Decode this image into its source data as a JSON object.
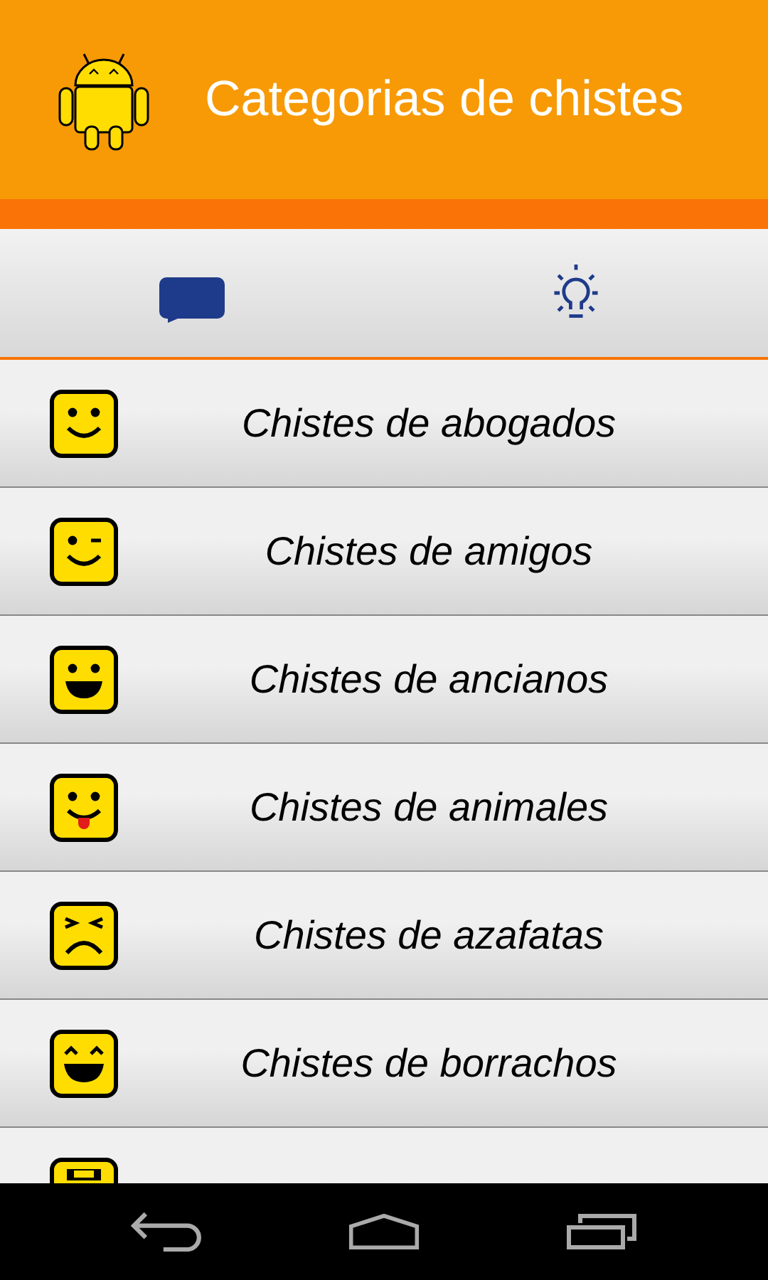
{
  "action_bar": {
    "title": "Categorias de chistes"
  },
  "tabs": [
    {
      "kind": "chat"
    },
    {
      "kind": "idea"
    }
  ],
  "categories": [
    {
      "kind": "smile",
      "label": "Chistes de abogados"
    },
    {
      "kind": "wink",
      "label": "Chistes de amigos"
    },
    {
      "kind": "grin",
      "label": "Chistes de ancianos"
    },
    {
      "kind": "tongue",
      "label": "Chistes de animales"
    },
    {
      "kind": "frown",
      "label": "Chistes de azafatas"
    },
    {
      "kind": "laugh",
      "label": "Chistes de borrachos"
    },
    {
      "kind": "teeth"
    }
  ],
  "nav_bar": [
    {
      "kind": "back"
    },
    {
      "kind": "home"
    },
    {
      "kind": "recents"
    }
  ]
}
